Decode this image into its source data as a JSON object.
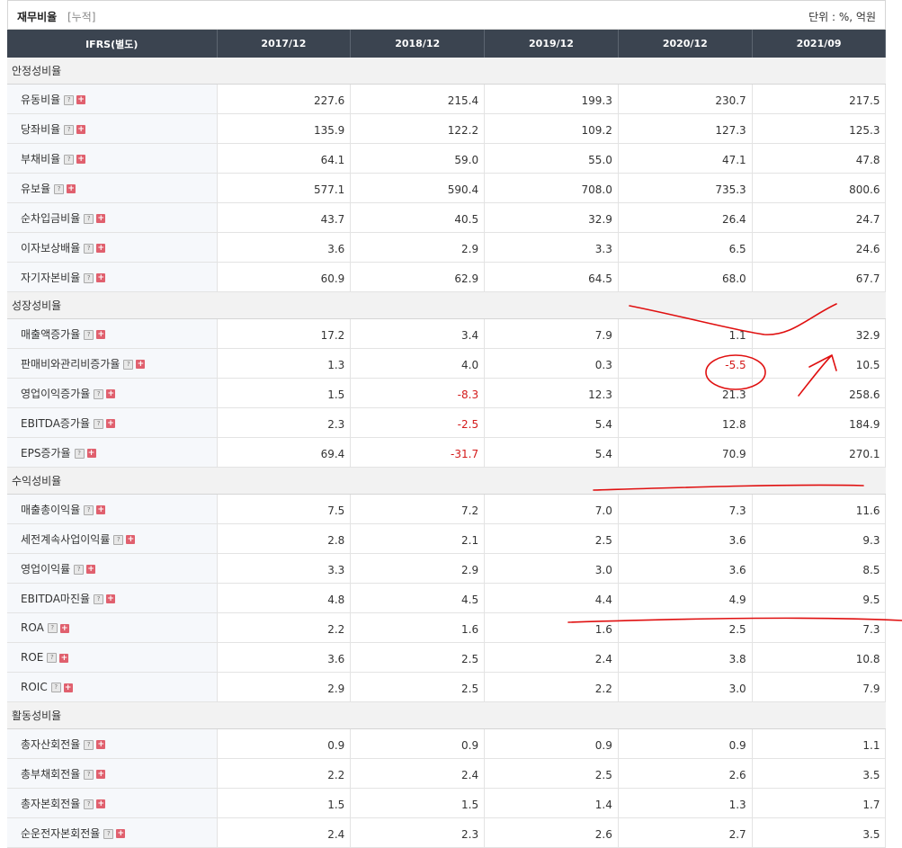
{
  "header": {
    "title": "재무비율",
    "subtitle": "[누적]",
    "unit": "단위 : %, 억원"
  },
  "table": {
    "columns": [
      "IFRS(별도)",
      "2017/12",
      "2018/12",
      "2019/12",
      "2020/12",
      "2021/09"
    ],
    "sections": [
      {
        "title": "안정성비율",
        "rows": [
          {
            "label": "유동비율",
            "values": [
              "227.6",
              "215.4",
              "199.3",
              "230.7",
              "217.5"
            ]
          },
          {
            "label": "당좌비율",
            "values": [
              "135.9",
              "122.2",
              "109.2",
              "127.3",
              "125.3"
            ]
          },
          {
            "label": "부채비율",
            "values": [
              "64.1",
              "59.0",
              "55.0",
              "47.1",
              "47.8"
            ]
          },
          {
            "label": "유보율",
            "values": [
              "577.1",
              "590.4",
              "708.0",
              "735.3",
              "800.6"
            ]
          },
          {
            "label": "순차입금비율",
            "values": [
              "43.7",
              "40.5",
              "32.9",
              "26.4",
              "24.7"
            ]
          },
          {
            "label": "이자보상배율",
            "values": [
              "3.6",
              "2.9",
              "3.3",
              "6.5",
              "24.6"
            ]
          },
          {
            "label": "자기자본비율",
            "values": [
              "60.9",
              "62.9",
              "64.5",
              "68.0",
              "67.7"
            ]
          }
        ]
      },
      {
        "title": "성장성비율",
        "rows": [
          {
            "label": "매출액증가율",
            "values": [
              "17.2",
              "3.4",
              "7.9",
              "1.1",
              "32.9"
            ]
          },
          {
            "label": "판매비와관리비증가율",
            "values": [
              "1.3",
              "4.0",
              "0.3",
              "-5.5",
              "10.5"
            ]
          },
          {
            "label": "영업이익증가율",
            "values": [
              "1.5",
              "-8.3",
              "12.3",
              "21.3",
              "258.6"
            ]
          },
          {
            "label": "EBITDA증가율",
            "values": [
              "2.3",
              "-2.5",
              "5.4",
              "12.8",
              "184.9"
            ]
          },
          {
            "label": "EPS증가율",
            "values": [
              "69.4",
              "-31.7",
              "5.4",
              "70.9",
              "270.1"
            ]
          }
        ]
      },
      {
        "title": "수익성비율",
        "rows": [
          {
            "label": "매출총이익율",
            "values": [
              "7.5",
              "7.2",
              "7.0",
              "7.3",
              "11.6"
            ]
          },
          {
            "label": "세전계속사업이익률",
            "values": [
              "2.8",
              "2.1",
              "2.5",
              "3.6",
              "9.3"
            ]
          },
          {
            "label": "영업이익률",
            "values": [
              "3.3",
              "2.9",
              "3.0",
              "3.6",
              "8.5"
            ]
          },
          {
            "label": "EBITDA마진율",
            "values": [
              "4.8",
              "4.5",
              "4.4",
              "4.9",
              "9.5"
            ]
          },
          {
            "label": "ROA",
            "values": [
              "2.2",
              "1.6",
              "1.6",
              "2.5",
              "7.3"
            ]
          },
          {
            "label": "ROE",
            "values": [
              "3.6",
              "2.5",
              "2.4",
              "3.8",
              "10.8"
            ]
          },
          {
            "label": "ROIC",
            "values": [
              "2.9",
              "2.5",
              "2.2",
              "3.0",
              "7.9"
            ]
          }
        ]
      },
      {
        "title": "활동성비율",
        "rows": [
          {
            "label": "총자산회전율",
            "values": [
              "0.9",
              "0.9",
              "0.9",
              "0.9",
              "1.1"
            ]
          },
          {
            "label": "총부채회전율",
            "values": [
              "2.2",
              "2.4",
              "2.5",
              "2.6",
              "3.5"
            ]
          },
          {
            "label": "총자본회전율",
            "values": [
              "1.5",
              "1.5",
              "1.4",
              "1.3",
              "1.7"
            ]
          },
          {
            "label": "순운전자본회전율",
            "values": [
              "2.4",
              "2.3",
              "2.6",
              "2.7",
              "3.5"
            ]
          }
        ]
      }
    ]
  },
  "icons": {
    "help": "question-icon",
    "expand": "plus-icon",
    "help_glyph": "?",
    "expand_glyph": "+"
  },
  "colors": {
    "header_bg": "#3b4450",
    "negative": "#d41a1a",
    "annotation": "#e01010",
    "label_bg": "#f6f8fb",
    "section_bg": "#f2f2f2"
  }
}
